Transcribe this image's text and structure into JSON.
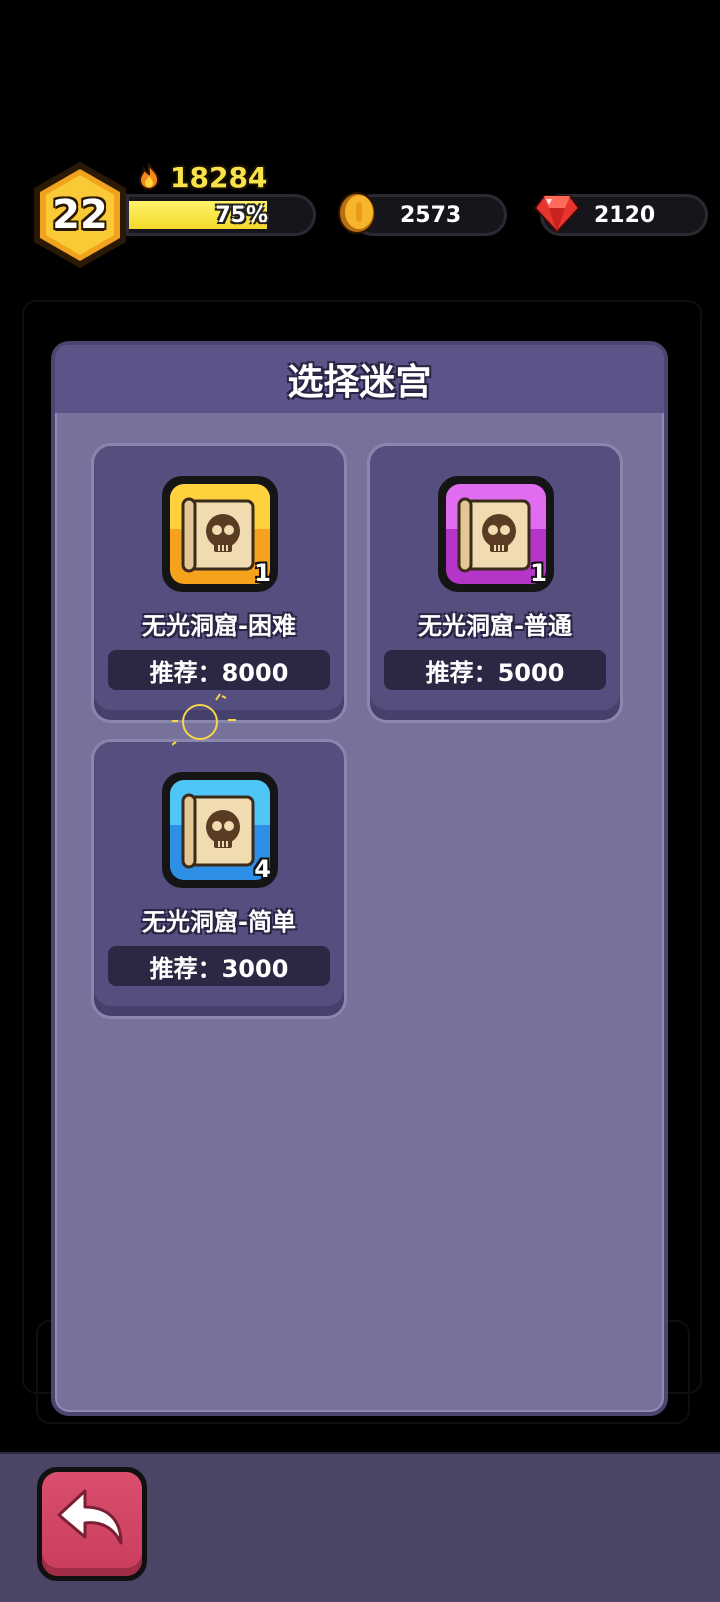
{
  "hud": {
    "level": "22",
    "power": "18284",
    "xp_percent_label": "75%",
    "xp_fraction": 0.75,
    "coins": "2573",
    "gems": "2120"
  },
  "panel": {
    "title": "选择迷宫"
  },
  "mazes": [
    {
      "name": "无光洞窟-困难",
      "recommend": "推荐：8000",
      "count": "1",
      "color": "#f6a21d",
      "color_light": "#ffd23d"
    },
    {
      "name": "无光洞窟-普通",
      "recommend": "推荐：5000",
      "count": "1",
      "color": "#b535c8",
      "color_light": "#e06cf0"
    },
    {
      "name": "无光洞窟-简单",
      "recommend": "推荐：3000",
      "count": "4",
      "color": "#2d8fe6",
      "color_light": "#50c6f7"
    }
  ],
  "colors": {
    "panel_bg": "#76729c",
    "card_bg": "#554f80",
    "power_text": "#f9e24a",
    "back_button": "#d94e6c"
  }
}
